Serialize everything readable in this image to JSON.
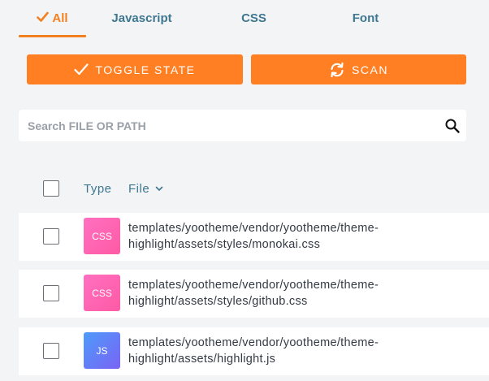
{
  "tabs": [
    {
      "label": "All",
      "active": true
    },
    {
      "label": "Javascript",
      "active": false
    },
    {
      "label": "CSS",
      "active": false
    },
    {
      "label": "Font",
      "active": false
    }
  ],
  "actions": {
    "toggle_label": "TOGGLE STATE",
    "scan_label": "SCAN"
  },
  "search": {
    "placeholder": "Search FILE OR PATH",
    "value": ""
  },
  "table": {
    "headers": {
      "type": "Type",
      "file": "File"
    },
    "rows": [
      {
        "type": "CSS",
        "path_line1": "templates/yootheme/vendor/yootheme/theme-",
        "path_line2": "highlight/assets/styles/monokai.css"
      },
      {
        "type": "CSS",
        "path_line1": "templates/yootheme/vendor/yootheme/theme-",
        "path_line2": "highlight/assets/styles/github.css"
      },
      {
        "type": "JS",
        "path_line1": "templates/yootheme/vendor/yootheme/theme-",
        "path_line2": "highlight/assets/highlight.js"
      }
    ]
  },
  "colors": {
    "accent": "#ff7f22",
    "tab_text": "#3f7790",
    "css_badge": "#ff5aa5",
    "js_badge": "#6c7cf8"
  },
  "icons": {
    "tab_all": "check-icon",
    "toggle": "check-icon",
    "scan": "sync-icon",
    "search": "search-icon",
    "sort": "chevron-down-icon"
  }
}
